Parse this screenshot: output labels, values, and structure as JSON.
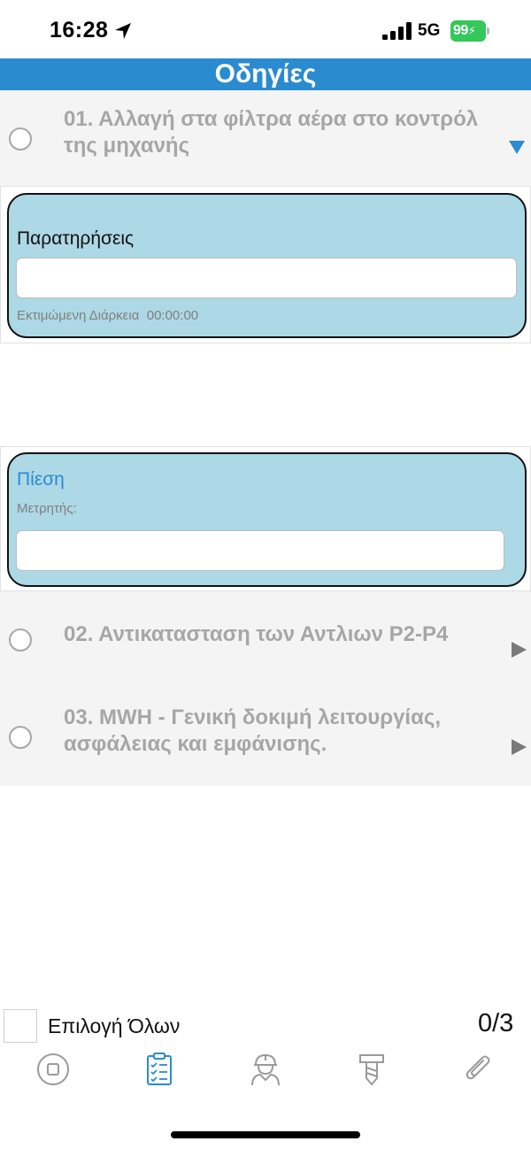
{
  "status_bar": {
    "time": "16:28",
    "network": "5G",
    "battery": "99"
  },
  "header": {
    "title": "Οδηγίες"
  },
  "steps": [
    {
      "title": "01. Αλλαγή στα φίλτρα αέρα στο κοντρόλ της μηχανής",
      "expanded": true,
      "checked": false
    },
    {
      "title": "02. Αντικατασταση των Αντλιων  P2-P4",
      "expanded": false,
      "checked": false
    },
    {
      "title": "03. MWH - Γενική δοκιμή λειτουργίας, ασφάλειας και εμφάνισης.",
      "expanded": false,
      "checked": false
    }
  ],
  "notes_panel": {
    "label": "Παρατηρήσεις",
    "input_value": "",
    "duration_label": "Εκτιμώμενη Διάρκεια",
    "duration_value": "00:00:00"
  },
  "pressure_panel": {
    "label": "Πίεση",
    "meter_label": "Μετρητής:",
    "input_value": ""
  },
  "footer": {
    "select_all_label": "Επιλογή Όλων",
    "counter": "0/3"
  },
  "tab_bar": {
    "tabs": [
      {
        "icon": "stop-circle-icon",
        "active": false
      },
      {
        "icon": "checklist-icon",
        "active": true
      },
      {
        "icon": "worker-icon",
        "active": false
      },
      {
        "icon": "tool-icon",
        "active": false
      },
      {
        "icon": "paperclip-icon",
        "active": false
      }
    ]
  },
  "colors": {
    "accent": "#2a8bd1",
    "panel_bg": "#add8e6",
    "row_bg": "#f4f4f4",
    "muted_text": "#a6a6a6",
    "inactive_icon": "#9a9a9a",
    "battery": "#34c759"
  }
}
